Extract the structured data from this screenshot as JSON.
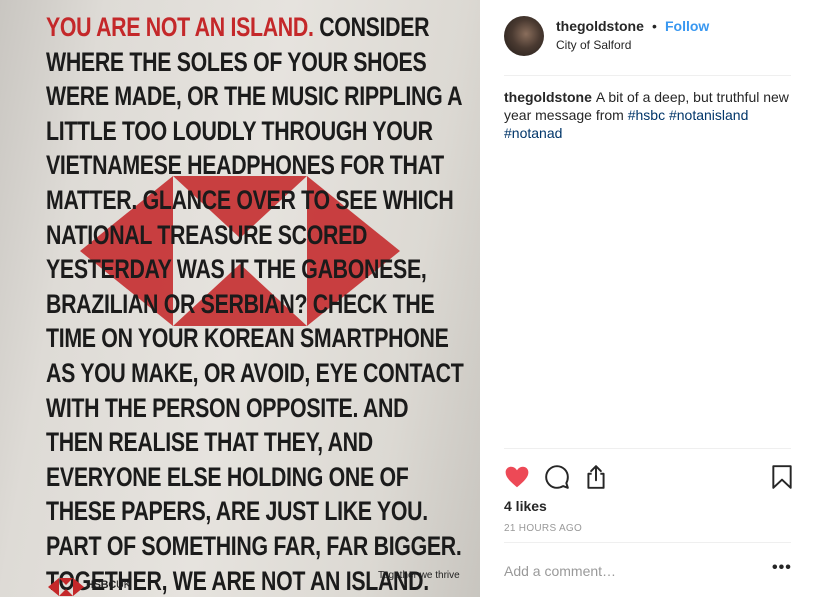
{
  "photo": {
    "ad_lead": "YOU ARE NOT AN ISLAND.",
    "ad_body": "CONSIDER WHERE THE SOLES OF YOUR SHOES WERE MADE, OR THE MUSIC RIPPLING A LITTLE TOO LOUDLY THROUGH YOUR VIETNAMESE HEADPHONES FOR THAT MATTER. GLANCE OVER TO SEE WHICH NATIONAL TREASURE SCORED YESTERDAY WAS IT THE GABONESE, BRAZILIAN OR SERBIAN? CHECK THE TIME ON YOUR KOREAN SMARTPHONE AS YOU MAKE, OR AVOID, EYE CONTACT WITH THE PERSON OPPOSITE. AND THEN REALISE THAT THEY, AND EVERYONE ELSE HOLDING ONE OF THESE PAPERS, ARE JUST LIKE YOU. PART OF SOMETHING FAR, FAR BIGGER. TOGETHER, WE ARE NOT AN ISLAND.",
    "brand": "HSBC",
    "brand_suffix": "UK",
    "tagline": "Together we thrive",
    "accent_color": "#c4282a"
  },
  "post": {
    "username": "thegoldstone",
    "separator": "•",
    "follow_label": "Follow",
    "location": "City of Salford",
    "caption_author": "thegoldstone",
    "caption_text": "A bit of a deep, but truthful new year message from",
    "hashtags": [
      "#hsbc",
      "#notanisland",
      "#notanad"
    ],
    "likes": "4 likes",
    "time_ago": "21 HOURS AGO",
    "comment_placeholder": "Add a comment…",
    "more_label": "•••",
    "icons": {
      "like": "heart-icon",
      "comment": "comment-icon",
      "share": "share-icon",
      "save": "bookmark-icon"
    },
    "liked_color": "#ed4956",
    "link_color": "#3897f0"
  }
}
